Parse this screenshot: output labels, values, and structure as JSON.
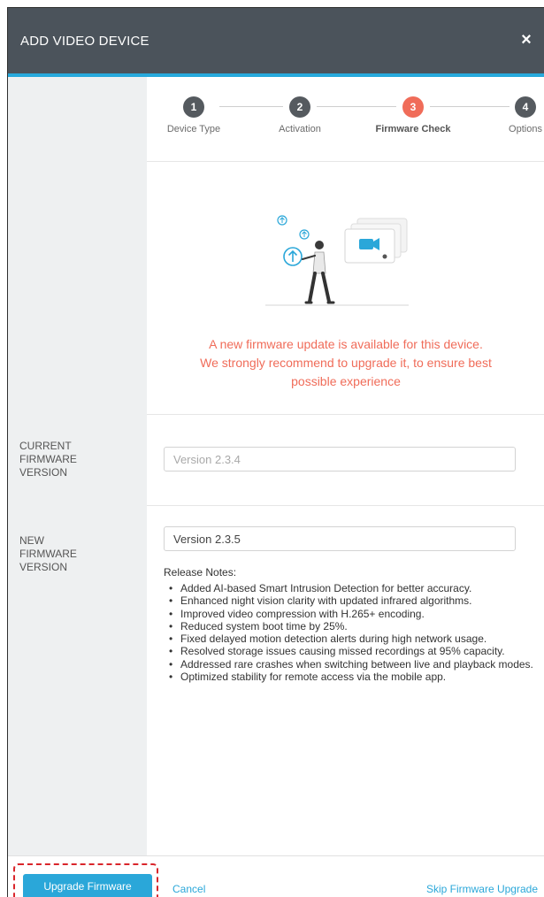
{
  "dialog": {
    "title": "ADD VIDEO DEVICE",
    "close_label": "×"
  },
  "stepper": {
    "steps": [
      {
        "number": "1",
        "label": "Device Type"
      },
      {
        "number": "2",
        "label": "Activation"
      },
      {
        "number": "3",
        "label": "Firmware Check"
      },
      {
        "number": "4",
        "label": "Options"
      }
    ],
    "active_step": 3
  },
  "notice": {
    "line1": "A new firmware update is available for this device.",
    "line2": "We strongly recommend to upgrade it, to ensure best",
    "line3": "possible experience"
  },
  "current_firmware": {
    "label_line1": "CURRENT",
    "label_line2": "FIRMWARE",
    "label_line3": "VERSION",
    "value": "Version 2.3.4"
  },
  "new_firmware": {
    "label_line1": "NEW",
    "label_line2": "FIRMWARE",
    "label_line3": "VERSION",
    "value": "Version 2.3.5"
  },
  "release_notes": {
    "title": "Release Notes:",
    "items": [
      "Added AI-based Smart Intrusion Detection for better accuracy.",
      "Enhanced night vision clarity with updated infrared algorithms.",
      "Improved video compression with H.265+ encoding.",
      "Reduced system boot time by 25%.",
      "Fixed delayed motion detection alerts during high network usage.",
      "Resolved storage issues causing missed recordings at 95% capacity.",
      "Addressed rare crashes when switching between live and playback modes.",
      "Optimized stability for remote access via the mobile app."
    ]
  },
  "footer": {
    "upgrade_label": "Upgrade Firmware",
    "cancel_label": "Cancel",
    "skip_label": "Skip Firmware Upgrade"
  },
  "colors": {
    "header": "#4b535b",
    "accent": "#27a9dc",
    "active_step": "#f06c59",
    "warning_text": "#f06c59",
    "highlight_border": "#d9252b"
  }
}
